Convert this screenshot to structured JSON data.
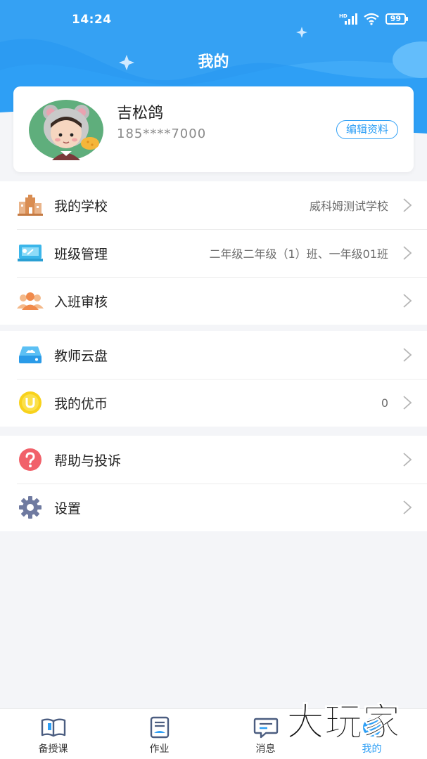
{
  "status": {
    "time": "14:24",
    "battery": "99",
    "hd": "HD"
  },
  "header": {
    "title": "我的"
  },
  "profile": {
    "name": "吉松鸽",
    "phone": "185****7000",
    "edit_label": "编辑资料"
  },
  "groups": [
    {
      "items": [
        {
          "label": "我的学校",
          "value": "威科姆测试学校",
          "icon": "school-icon"
        },
        {
          "label": "班级管理",
          "value": "二年级二年级（1）班、一年级01班",
          "icon": "class-board-icon"
        },
        {
          "label": "入班审核",
          "value": "",
          "icon": "people-icon"
        }
      ]
    },
    {
      "items": [
        {
          "label": "教师云盘",
          "value": "",
          "icon": "cloud-drive-icon"
        },
        {
          "label": "我的优币",
          "value": "0",
          "icon": "coin-icon"
        }
      ]
    },
    {
      "items": [
        {
          "label": "帮助与投诉",
          "value": "",
          "icon": "help-icon"
        },
        {
          "label": "设置",
          "value": "",
          "icon": "gear-icon"
        }
      ]
    }
  ],
  "tabbar": [
    {
      "label": "备授课",
      "icon": "book-icon",
      "active": false
    },
    {
      "label": "作业",
      "icon": "homework-icon",
      "active": false
    },
    {
      "label": "消息",
      "icon": "message-icon",
      "active": false
    },
    {
      "label": "我的",
      "icon": "profile-icon",
      "active": true
    }
  ],
  "watermark": {
    "text": "大玩家"
  },
  "colors": {
    "primary": "#2e9ff5",
    "header_light": "#5cb9fa",
    "page_bg": "#f4f5f8"
  }
}
